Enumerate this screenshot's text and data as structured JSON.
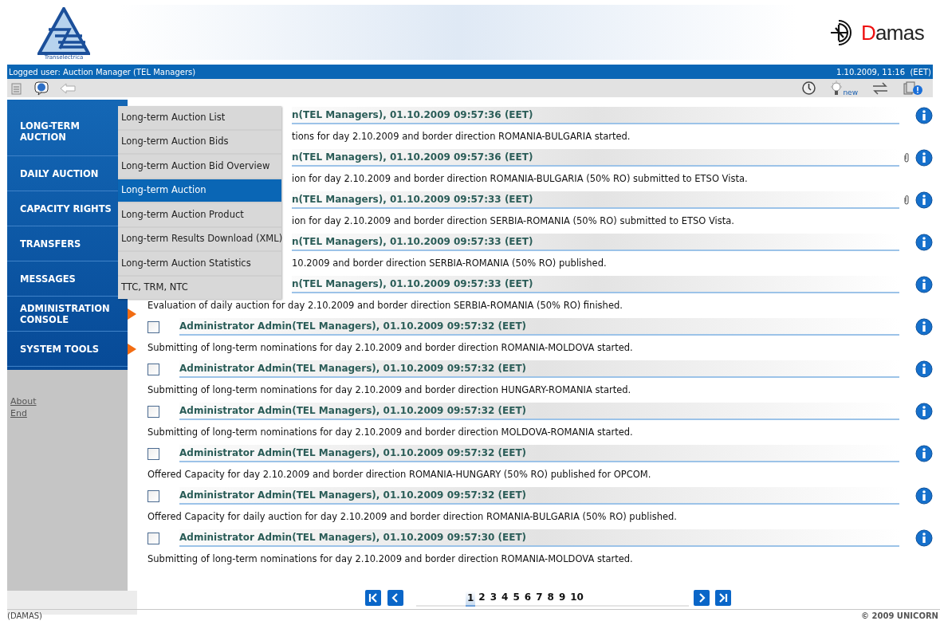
{
  "header": {
    "logo_caption": "Transelectrica",
    "brand": "Damas"
  },
  "user_bar": {
    "logged_user": "Logged user: Auction Manager (TEL Managers)",
    "datetime": "1.10.2009, 11:16  (EET)"
  },
  "toolbar_badge": "new",
  "sidebar": {
    "items": [
      {
        "label": "LONG-TERM AUCTION",
        "arrow": false
      },
      {
        "label": "DAILY AUCTION",
        "arrow": false
      },
      {
        "label": "CAPACITY RIGHTS",
        "arrow": false
      },
      {
        "label": "TRANSFERS",
        "arrow": false
      },
      {
        "label": "MESSAGES",
        "arrow": false
      },
      {
        "label": "ADMINISTRATION CONSOLE",
        "arrow": true
      },
      {
        "label": "SYSTEM TOOLS",
        "arrow": true
      }
    ],
    "links": [
      "About",
      "End"
    ]
  },
  "menu": [
    {
      "label": "Long-term Auction List",
      "selected": false
    },
    {
      "label": "Long-term Auction Bids",
      "selected": false
    },
    {
      "label": "Long-term Auction Bid Overview",
      "selected": false
    },
    {
      "label": "Long-term Auction",
      "selected": true
    },
    {
      "label": "Long-term Auction Product",
      "selected": false
    },
    {
      "label": "Long-term Results Download (XML)",
      "selected": false
    },
    {
      "label": "Long-term Auction Statistics",
      "selected": false
    },
    {
      "label": "TTC, TRM, NTC",
      "selected": false
    }
  ],
  "messages": [
    {
      "header": "n(TEL Managers), 01.10.2009 09:57:36 (EET)",
      "text": "tions for day 2.10.2009 and border direction ROMANIA-BULGARIA started.",
      "behind_menu": true,
      "text_behind_menu": true,
      "attachment": false
    },
    {
      "header": "n(TEL Managers), 01.10.2009 09:57:36 (EET)",
      "text": "ion for day 2.10.2009 and border direction ROMANIA-BULGARIA (50% RO) submitted to ETSO Vista.",
      "behind_menu": true,
      "text_behind_menu": true,
      "attachment": true
    },
    {
      "header": "n(TEL Managers), 01.10.2009 09:57:33 (EET)",
      "text": "ion for day 2.10.2009 and border direction SERBIA-ROMANIA (50% RO) submitted to ETSO Vista.",
      "behind_menu": true,
      "text_behind_menu": true,
      "attachment": true
    },
    {
      "header": "n(TEL Managers), 01.10.2009 09:57:33 (EET)",
      "text": "10.2009 and border direction SERBIA-ROMANIA (50% RO) published.",
      "behind_menu": true,
      "text_behind_menu": true,
      "attachment": false
    },
    {
      "header": "n(TEL Managers), 01.10.2009 09:57:33 (EET)",
      "text": "Evaluation of daily auction for day 2.10.2009 and border direction SERBIA-ROMANIA (50% RO) finished.",
      "behind_menu": true,
      "attachment": false
    },
    {
      "checked": false,
      "header": "Administrator Admin(TEL Managers), 01.10.2009 09:57:32 (EET)",
      "text": "Submitting of long-term nominations for day 2.10.2009 and border direction ROMANIA-MOLDOVA started.",
      "behind_menu": false,
      "attachment": false
    },
    {
      "checked": false,
      "header": "Administrator Admin(TEL Managers), 01.10.2009 09:57:32 (EET)",
      "text": "Submitting of long-term nominations for day 2.10.2009 and border direction HUNGARY-ROMANIA started.",
      "behind_menu": false,
      "attachment": false
    },
    {
      "checked": false,
      "header": "Administrator Admin(TEL Managers), 01.10.2009 09:57:32 (EET)",
      "text": "Submitting of long-term nominations for day 2.10.2009 and border direction MOLDOVA-ROMANIA started.",
      "behind_menu": false,
      "attachment": false
    },
    {
      "checked": false,
      "header": "Administrator Admin(TEL Managers), 01.10.2009 09:57:32 (EET)",
      "text": "Offered Capacity for day 2.10.2009 and border direction ROMANIA-HUNGARY (50% RO) published for OPCOM.",
      "behind_menu": false,
      "attachment": false
    },
    {
      "checked": false,
      "header": "Administrator Admin(TEL Managers), 01.10.2009 09:57:32 (EET)",
      "text": "Offered Capacity for daily auction for day 2.10.2009 and border direction ROMANIA-BULGARIA (50% RO) published.",
      "behind_menu": false,
      "attachment": false
    },
    {
      "checked": false,
      "header": "Administrator Admin(TEL Managers), 01.10.2009 09:57:30 (EET)",
      "text": "Submitting of long-term nominations for day 2.10.2009 and border direction ROMANIA-MOLDOVA started.",
      "behind_menu": false,
      "attachment": false
    }
  ],
  "pagination": [
    {
      "label": "1",
      "selected": true
    },
    {
      "label": "2",
      "selected": false
    },
    {
      "label": "3",
      "selected": false
    },
    {
      "label": "4",
      "selected": false
    },
    {
      "label": "5",
      "selected": false
    },
    {
      "label": "6",
      "selected": false
    },
    {
      "label": "7",
      "selected": false
    },
    {
      "label": "8",
      "selected": false
    },
    {
      "label": "9",
      "selected": false
    },
    {
      "label": "10",
      "selected": false
    }
  ],
  "footer": {
    "left": "(DAMAS)",
    "right": "© 2009 UNICORN"
  }
}
